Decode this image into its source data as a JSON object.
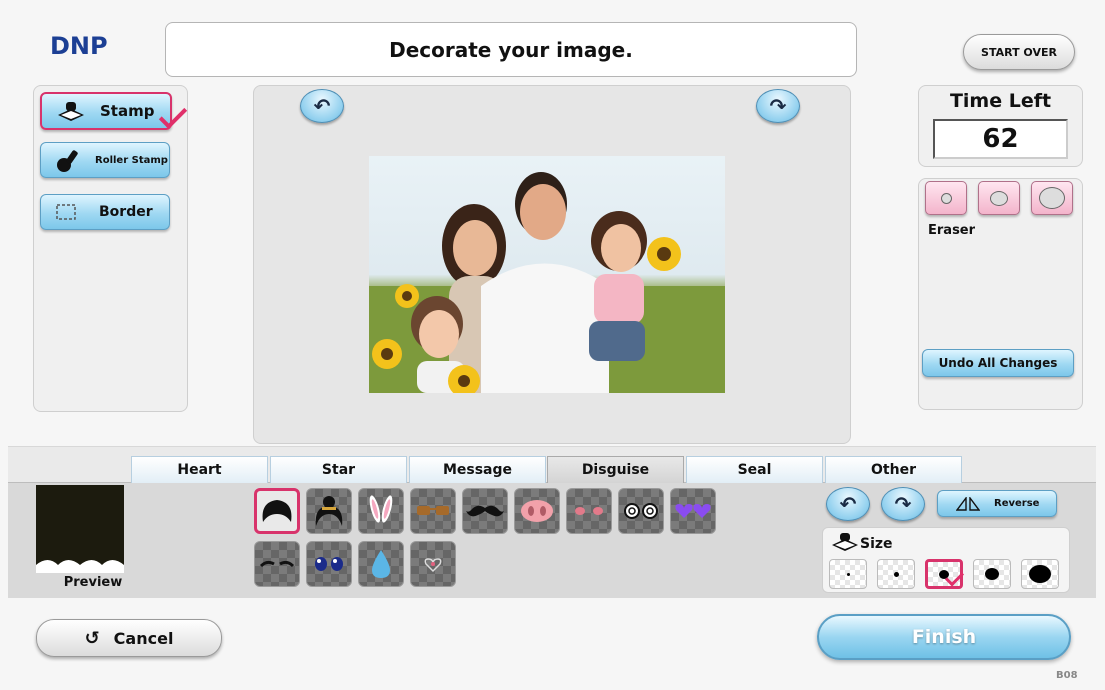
{
  "brand": "DNP",
  "header": {
    "title": "Decorate your image."
  },
  "start_over_label": "START OVER",
  "tools": [
    {
      "label": "Stamp",
      "icon": "stamp-icon",
      "selected": true
    },
    {
      "label": "Roller Stamp",
      "icon": "roller-stamp-icon",
      "selected": false
    },
    {
      "label": "Border",
      "icon": "border-icon",
      "selected": false
    }
  ],
  "timer": {
    "label": "Time Left",
    "value": "62"
  },
  "eraser": {
    "label": "Eraser",
    "sizes": [
      "small",
      "medium",
      "large"
    ]
  },
  "undo_all_label": "Undo All Changes",
  "categories": {
    "tabs": [
      "Heart",
      "Star",
      "Message",
      "Disguise",
      "Seal",
      "Other"
    ],
    "active": "Disguise"
  },
  "preview_label": "Preview",
  "stamps": [
    {
      "name": "afro-wig-stamp",
      "selected": true
    },
    {
      "name": "updo-wig-stamp"
    },
    {
      "name": "bunny-ears-stamp"
    },
    {
      "name": "glasses-stamp"
    },
    {
      "name": "mustache-stamp"
    },
    {
      "name": "pig-nose-stamp"
    },
    {
      "name": "blush-cheeks-stamp"
    },
    {
      "name": "swirl-glasses-stamp"
    },
    {
      "name": "heart-glasses-stamp"
    },
    {
      "name": "eyebrows-stamp"
    },
    {
      "name": "anime-eyes-stamp"
    },
    {
      "name": "water-drop-stamp"
    },
    {
      "name": "heart-sparkle-stamp"
    }
  ],
  "reverse_label": "Reverse",
  "size": {
    "label": "Size",
    "options": 5,
    "selected_index": 2
  },
  "cancel_label": "Cancel",
  "finish_label": "Finish",
  "screen_code": "B08",
  "colors": {
    "accent_pink": "#d8336b",
    "button_blue": "#9fd8f2",
    "finish_blue": "#7fcbea"
  }
}
